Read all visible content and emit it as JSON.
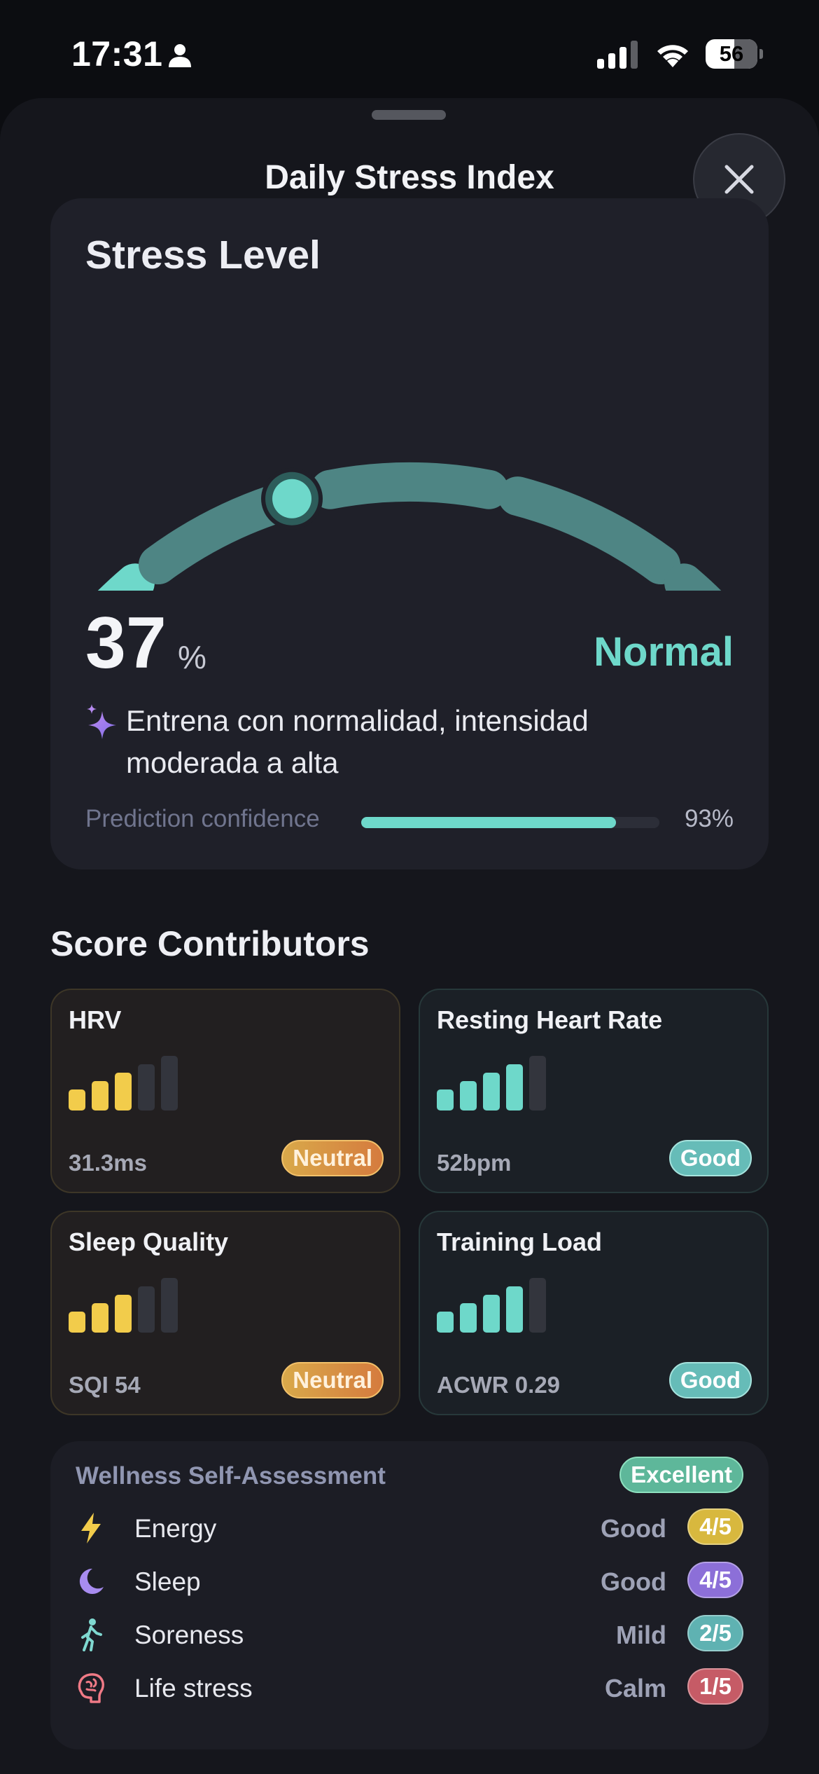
{
  "status_bar": {
    "time": "17:31",
    "battery": "56"
  },
  "sheet": {
    "title": "Daily Stress Index"
  },
  "stress": {
    "heading": "Stress Level",
    "score": "37",
    "unit": "%",
    "score_fraction": 0.37,
    "status": "Normal",
    "recommendation": "Entrena con normalidad, intensidad moderada a alta",
    "confidence_label": "Prediction confidence",
    "confidence_value": "93%",
    "confidence_fraction": 0.93
  },
  "contributors": {
    "title": "Score Contributors",
    "items": [
      {
        "name": "HRV",
        "value": "31.3ms",
        "badge": "Neutral",
        "level": 3,
        "max": 5,
        "tone": "neutral"
      },
      {
        "name": "Resting Heart Rate",
        "value": "52bpm",
        "badge": "Good",
        "level": 4,
        "max": 5,
        "tone": "good"
      },
      {
        "name": "Sleep Quality",
        "value": "SQI 54",
        "badge": "Neutral",
        "level": 3,
        "max": 5,
        "tone": "neutral"
      },
      {
        "name": "Training Load",
        "value": "ACWR 0.29",
        "badge": "Good",
        "level": 4,
        "max": 5,
        "tone": "good"
      }
    ]
  },
  "wellness": {
    "title": "Wellness Self-Assessment",
    "overall": "Excellent",
    "items": [
      {
        "icon": "lightning-icon",
        "label": "Energy",
        "status": "Good",
        "score": "4/5",
        "color": "#d8b83e"
      },
      {
        "icon": "moon-icon",
        "label": "Sleep",
        "status": "Good",
        "score": "4/5",
        "color": "#8c6fd8"
      },
      {
        "icon": "walking-person-icon",
        "label": "Soreness",
        "status": "Mild",
        "score": "2/5",
        "color": "#5fb2b2"
      },
      {
        "icon": "brain-icon",
        "label": "Life stress",
        "status": "Calm",
        "score": "1/5",
        "color": "#c65b66"
      }
    ]
  },
  "colors": {
    "accent": "#6ED8CA",
    "neutral_bar": "#F2CC4B",
    "good_bar": "#6ED8CA",
    "inactive_bar": "#33353d",
    "gauge_inactive": "#4E8584"
  }
}
